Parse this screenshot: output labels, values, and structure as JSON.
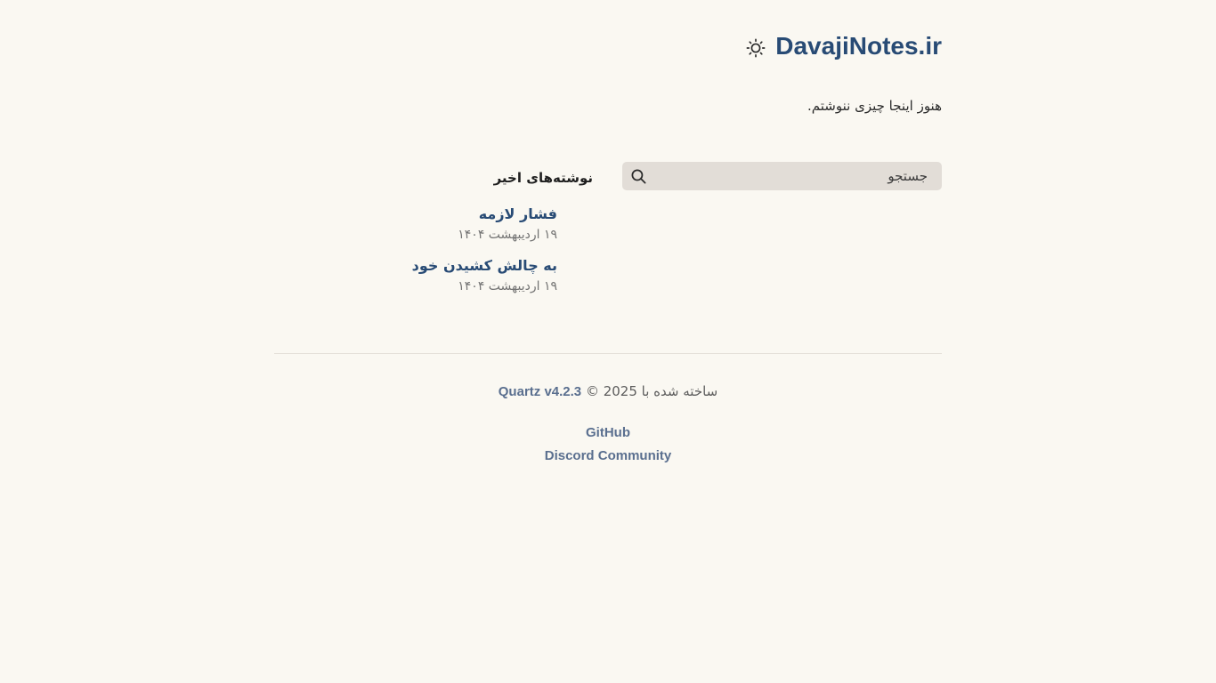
{
  "header": {
    "site_title": "DavajiNotes.ir",
    "theme_icon": "sun-icon"
  },
  "intro": {
    "text": "هنوز اینجا چیزی ننوشتم."
  },
  "search": {
    "placeholder": "جستجو",
    "icon": "search-icon"
  },
  "recent_notes": {
    "heading": "نوشته‌های اخیر",
    "items": [
      {
        "title": "فشار لازمه",
        "date": "۱۹ اردیبهشت ۱۴۰۴"
      },
      {
        "title": "به چالش کشیدن خود",
        "date": "۱۹ اردیبهشت ۱۴۰۴"
      }
    ]
  },
  "footer": {
    "built_with": "ساخته شده با",
    "quartz_label": "Quartz v4.2.3",
    "copyright": "© 2025",
    "links": [
      {
        "label": "GitHub"
      },
      {
        "label": "Discord Community"
      }
    ]
  },
  "colors": {
    "background": "#faf8f2",
    "accent": "#284b75",
    "muted_link": "#5a6f8f",
    "search_bg": "#e2ddd7"
  }
}
